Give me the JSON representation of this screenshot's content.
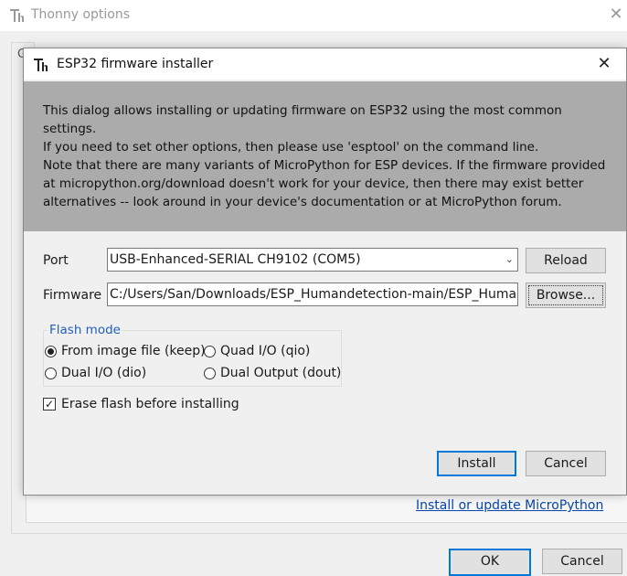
{
  "background_window": {
    "title": "Thonny options",
    "tab_partial": "G",
    "link": "Install or update MicroPython",
    "ok_label": "OK",
    "cancel_label": "Cancel"
  },
  "dialog": {
    "title": "ESP32 firmware installer",
    "info_paragraph_1": "This dialog allows installing or updating firmware on ESP32 using the most common settings.\nIf you need to set other options, then please use 'esptool' on the command line.",
    "info_paragraph_2": "Note that there are many variants of MicroPython for ESP devices. If the firmware provided\nat micropython.org/download doesn't work for your device, then there may exist better\nalternatives -- look around in your device's documentation or at MicroPython forum.",
    "port_label": "Port",
    "port_value": "USB-Enhanced-SERIAL CH9102 (COM5)",
    "reload_label": "Reload",
    "firmware_label": "Firmware",
    "firmware_value": "C:/Users/San/Downloads/ESP_Humandetection-main/ESP_Humand",
    "browse_label": "Browse...",
    "flash_mode_title": "Flash mode",
    "flash_modes": [
      {
        "label": "From image file (keep)",
        "selected": true
      },
      {
        "label": "Quad I/O (qio)",
        "selected": false
      },
      {
        "label": "Dual I/O (dio)",
        "selected": false
      },
      {
        "label": "Dual Output (dout)",
        "selected": false
      }
    ],
    "erase_label": "Erase flash before installing",
    "erase_checked": true,
    "install_label": "Install",
    "cancel_label": "Cancel"
  }
}
